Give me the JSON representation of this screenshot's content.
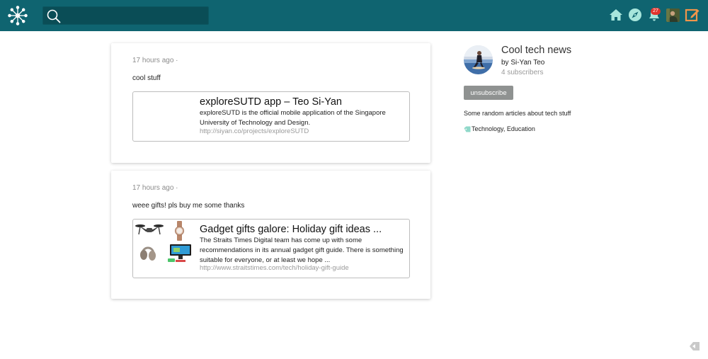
{
  "header": {
    "search_placeholder": "",
    "notification_count": "27",
    "icons": [
      "logo-icon",
      "search-icon",
      "home-icon",
      "compass-icon",
      "bell-icon",
      "user-avatar",
      "compose-icon"
    ],
    "bar_color": "#0f6470"
  },
  "posts": [
    {
      "timestamp": "17 hours ago ·",
      "text": "cool stuff",
      "link": {
        "title": "exploreSUTD app – Teo Si-Yan",
        "description": "exploreSUTD is the official mobile application of the Singapore University of Technology and Design.",
        "url": "http://siyan.co/projects/exploreSUTD"
      }
    },
    {
      "timestamp": "17 hours ago ·",
      "text": "weee gifts! pls buy me some thanks",
      "link": {
        "title": "Gadget gifts galore: Holiday gift ideas ...",
        "description": "The Straits Times Digital team has come up with some recommendations in its annual gadget gift guide. There is something suitable for everyone, or at least we hope ...",
        "url": "http://www.straitstimes.com/tech/holiday-gift-guide"
      }
    }
  ],
  "channel": {
    "title": "Cool tech news",
    "author": "by Si-Yan Teo",
    "subscribers": "4 subscribers",
    "unsubscribe_label": "unsubscribe",
    "description": "Some random articles about tech stuff",
    "tags": "Technology, Education"
  }
}
